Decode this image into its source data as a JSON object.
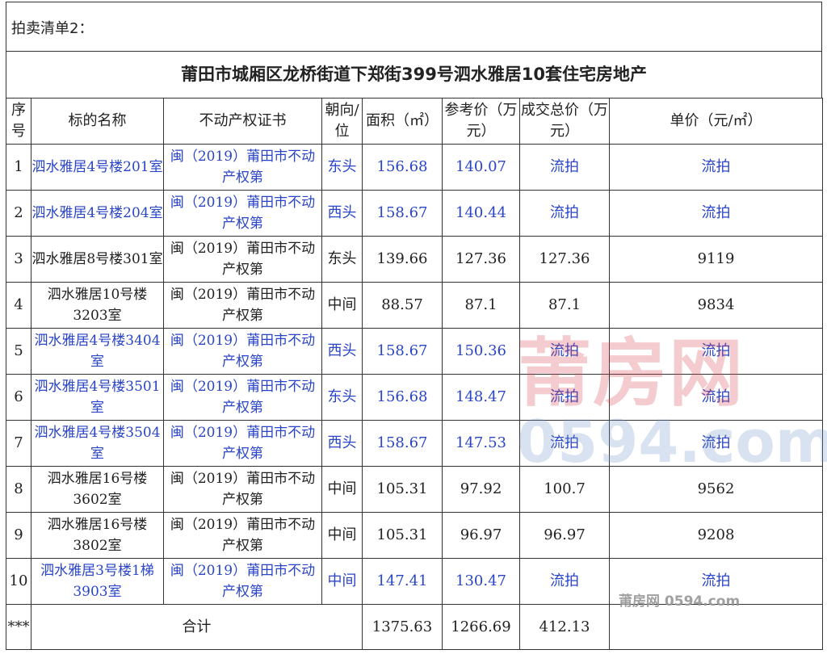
{
  "list_title": "拍卖清单2：",
  "main_title": "莆田市城厢区龙桥街道下郑街399号泗水雅居10套住宅房地产",
  "columns": {
    "no": "序号",
    "name": "标的名称",
    "cert": "不动产权证书",
    "orient": "朝向/位",
    "area": "面积（㎡）",
    "ref_price": "参考价（万元）",
    "deal_price": "成交总价（万元）",
    "unit_price": "单价（元/㎡）"
  },
  "rows": [
    {
      "no": "1",
      "name": "泗水雅居4号楼201室",
      "cert": "闽（2019）莆田市不动产权第",
      "orient": "东头",
      "area": "156.68",
      "ref": "140.07",
      "deal": "流拍",
      "unit": "流拍",
      "highlight": true
    },
    {
      "no": "2",
      "name": "泗水雅居4号楼204室",
      "cert": "闽（2019）莆田市不动产权第",
      "orient": "西头",
      "area": "158.67",
      "ref": "140.44",
      "deal": "流拍",
      "unit": "流拍",
      "highlight": true
    },
    {
      "no": "3",
      "name": "泗水雅居8号楼301室",
      "cert": "闽（2019）莆田市不动产权第",
      "orient": "东头",
      "area": "139.66",
      "ref": "127.36",
      "deal": "127.36",
      "unit": "9119",
      "highlight": false
    },
    {
      "no": "4",
      "name": "泗水雅居10号楼3203室",
      "cert": "闽（2019）莆田市不动产权第",
      "orient": "中间",
      "area": "88.57",
      "ref": "87.1",
      "deal": "87.1",
      "unit": "9834",
      "highlight": false
    },
    {
      "no": "5",
      "name": "泗水雅居4号楼3404室",
      "cert": "闽（2019）莆田市不动产权第",
      "orient": "西头",
      "area": "158.67",
      "ref": "150.36",
      "deal": "流拍",
      "unit": "流拍",
      "highlight": true
    },
    {
      "no": "6",
      "name": "泗水雅居4号楼3501室",
      "cert": "闽（2019）莆田市不动产权第",
      "orient": "东头",
      "area": "156.68",
      "ref": "148.47",
      "deal": "流拍",
      "unit": "流拍",
      "highlight": true
    },
    {
      "no": "7",
      "name": "泗水雅居4号楼3504室",
      "cert": "闽（2019）莆田市不动产权第",
      "orient": "西头",
      "area": "158.67",
      "ref": "147.53",
      "deal": "流拍",
      "unit": "流拍",
      "highlight": true
    },
    {
      "no": "8",
      "name": "泗水雅居16号楼3602室",
      "cert": "闽（2019）莆田市不动产权第",
      "orient": "中间",
      "area": "105.31",
      "ref": "97.92",
      "deal": "100.7",
      "unit": "9562",
      "highlight": false
    },
    {
      "no": "9",
      "name": "泗水雅居16号楼3802室",
      "cert": "闽（2019）莆田市不动产权第",
      "orient": "中间",
      "area": "105.31",
      "ref": "96.97",
      "deal": "96.97",
      "unit": "9208",
      "highlight": false
    },
    {
      "no": "10",
      "name": "泗水雅居3号楼1梯3903室",
      "cert": "闽（2019）莆田市不动产权第",
      "orient": "中间",
      "area": "147.41",
      "ref": "130.47",
      "deal": "流拍",
      "unit": "流拍",
      "highlight": true
    }
  ],
  "total": {
    "no": "***",
    "label": "合计",
    "area": "1375.63",
    "ref": "1266.69",
    "deal": "412.13",
    "unit": ""
  },
  "watermark": {
    "cn": "莆房网",
    "num": "0594.com",
    "small": "莆房网 0594.com"
  },
  "colors": {
    "highlight_text": "#2a45c7",
    "watermark_red": "#d74650",
    "watermark_blue": "#7896c8"
  }
}
